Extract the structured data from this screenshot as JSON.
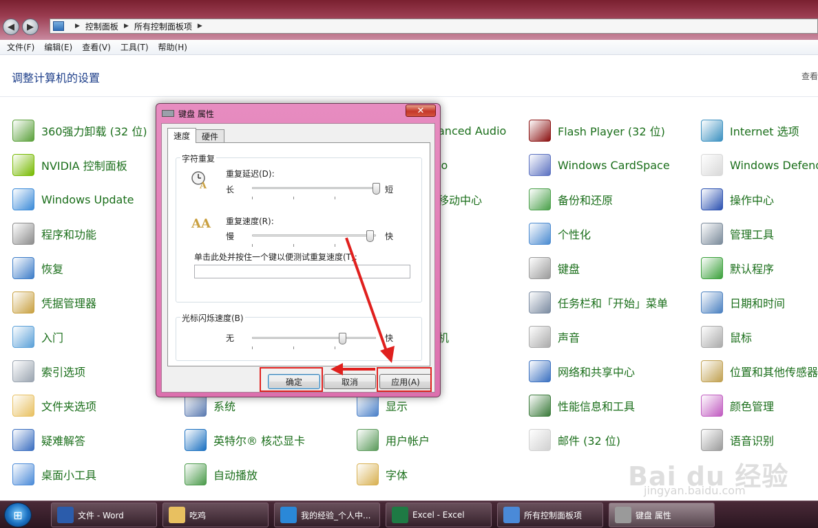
{
  "address_bar": {
    "crumbs": [
      "控制面板",
      "所有控制面板项"
    ]
  },
  "menu": {
    "items": [
      "文件(F)",
      "编辑(E)",
      "查看(V)",
      "工具(T)",
      "帮助(H)"
    ]
  },
  "page": {
    "heading": "调整计算机的设置",
    "view_by": "查看"
  },
  "items": [
    {
      "label": "360强力卸载 (32 位)",
      "icon": "uninstall-icon",
      "color": "#5aa03a"
    },
    {
      "label": "NVIDIA 控制面板",
      "icon": "nvidia-icon",
      "color": "#76b900"
    },
    {
      "label": "Windows Update",
      "icon": "windows-update-icon",
      "color": "#3a8ad8"
    },
    {
      "label": "程序和功能",
      "icon": "programs-icon",
      "color": "#8c8c8c"
    },
    {
      "label": "恢复",
      "icon": "recovery-icon",
      "color": "#3c7cc8"
    },
    {
      "label": "凭据管理器",
      "icon": "credential-icon",
      "color": "#c8a040"
    },
    {
      "label": "入门",
      "icon": "getting-started-icon",
      "color": "#5aa0d8"
    },
    {
      "label": "索引选项",
      "icon": "index-icon",
      "color": "#9aa4b0"
    },
    {
      "label": "文件夹选项",
      "icon": "folder-options-icon",
      "color": "#e8c060"
    },
    {
      "label": "疑难解答",
      "icon": "troubleshoot-icon",
      "color": "#3a6ec0"
    },
    {
      "label": "桌面小工具",
      "icon": "gadgets-icon",
      "color": "#4a8ad8"
    },
    {
      "label": "系统",
      "icon": "system-icon",
      "color": "#5a7ab0"
    },
    {
      "label": "英特尔® 核芯显卡",
      "icon": "intel-graphics-icon",
      "color": "#1a70c0"
    },
    {
      "label": "自动播放",
      "icon": "autoplay-icon",
      "color": "#4a9a4a"
    },
    {
      "label": "anced Audio",
      "icon": "audio-icon",
      "color": "#888888"
    },
    {
      "label": "io",
      "icon": "speech-icon",
      "color": "#888888"
    },
    {
      "label": "移动中心",
      "icon": "mobility-icon",
      "color": "#888888"
    },
    {
      "label": "机",
      "icon": "device-icon",
      "color": "#888888"
    },
    {
      "label": "显示",
      "icon": "display-icon",
      "color": "#4a80c8"
    },
    {
      "label": "用户帐户",
      "icon": "user-accounts-icon",
      "color": "#5a9a5a"
    },
    {
      "label": "字体",
      "icon": "fonts-icon",
      "color": "#d8b050"
    },
    {
      "label": "Flash Player (32 位)",
      "icon": "flash-icon",
      "color": "#8a1010"
    },
    {
      "label": "Windows CardSpace",
      "icon": "cardspace-icon",
      "color": "#5a70c0"
    },
    {
      "label": "备份和还原",
      "icon": "backup-icon",
      "color": "#4aa04a"
    },
    {
      "label": "个性化",
      "icon": "personalize-icon",
      "color": "#4a8ad0"
    },
    {
      "label": "键盘",
      "icon": "keyboard-icon",
      "color": "#9a9a9a"
    },
    {
      "label": "任务栏和「开始」菜单",
      "icon": "taskbar-icon",
      "color": "#7a8aa0"
    },
    {
      "label": "声音",
      "icon": "sound-icon",
      "color": "#aaaaaa"
    },
    {
      "label": "网络和共享中心",
      "icon": "network-icon",
      "color": "#3a70c0"
    },
    {
      "label": "性能信息和工具",
      "icon": "performance-icon",
      "color": "#3a7a3a"
    },
    {
      "label": "邮件 (32 位)",
      "icon": "mail-icon",
      "color": "#d0d0d0"
    },
    {
      "label": "Internet 选项",
      "icon": "internet-options-icon",
      "color": "#3a90c0"
    },
    {
      "label": "Windows Defender",
      "icon": "defender-icon",
      "color": "#d8d8d8"
    },
    {
      "label": "操作中心",
      "icon": "action-center-icon",
      "color": "#2a50b0"
    },
    {
      "label": "管理工具",
      "icon": "admin-tools-icon",
      "color": "#7a8a9a"
    },
    {
      "label": "默认程序",
      "icon": "default-programs-icon",
      "color": "#3aa03a"
    },
    {
      "label": "日期和时间",
      "icon": "datetime-icon",
      "color": "#4a80c0"
    },
    {
      "label": "鼠标",
      "icon": "mouse-icon",
      "color": "#aaaaaa"
    },
    {
      "label": "位置和其他传感器",
      "icon": "sensors-icon",
      "color": "#c0a050"
    },
    {
      "label": "颜色管理",
      "icon": "color-management-icon",
      "color": "#c05ac0"
    },
    {
      "label": "语音识别",
      "icon": "microphone-icon",
      "color": "#9a9a9a"
    }
  ],
  "dialog": {
    "title": "键盘 属性",
    "close_glyph": "✕",
    "tabs": [
      "速度",
      "硬件"
    ],
    "repeat_group": "字符重复",
    "repeat_delay_label": "重复延迟(D):",
    "delay_long": "长",
    "delay_short": "短",
    "delay_level": 1.0,
    "repeat_rate_label": "重复速度(R):",
    "rate_slow": "慢",
    "rate_fast": "快",
    "rate_level": 0.95,
    "test_label": "单击此处并按住一个键以便测试重复速度(T):",
    "cursor_group": "光标闪烁速度(B)",
    "blink_none": "无",
    "blink_fast": "快",
    "blink_level": 0.73,
    "ok": "确定",
    "cancel": "取消",
    "apply": "应用(A)"
  },
  "annotation": {
    "color": "#e0201e"
  },
  "taskbar": {
    "start_glyph": "⊞",
    "tasks": [
      {
        "label": "文件 - Word",
        "icon": "word-icon",
        "color": "#2b5cab"
      },
      {
        "label": "吃鸡",
        "icon": "folder-icon",
        "color": "#e8c060"
      },
      {
        "label": "我的经验_个人中...",
        "icon": "browser-icon",
        "color": "#2a88d8"
      },
      {
        "label": "Excel - Excel",
        "icon": "excel-icon",
        "color": "#1e7a44"
      },
      {
        "label": "所有控制面板项",
        "icon": "control-panel-icon",
        "color": "#4a8ad8"
      },
      {
        "label": "键盘 属性",
        "icon": "keyboard-icon",
        "color": "#9a9a9a"
      }
    ]
  },
  "watermark": {
    "brand": "Bai du 经验",
    "url": "jingyan.baidu.com"
  }
}
